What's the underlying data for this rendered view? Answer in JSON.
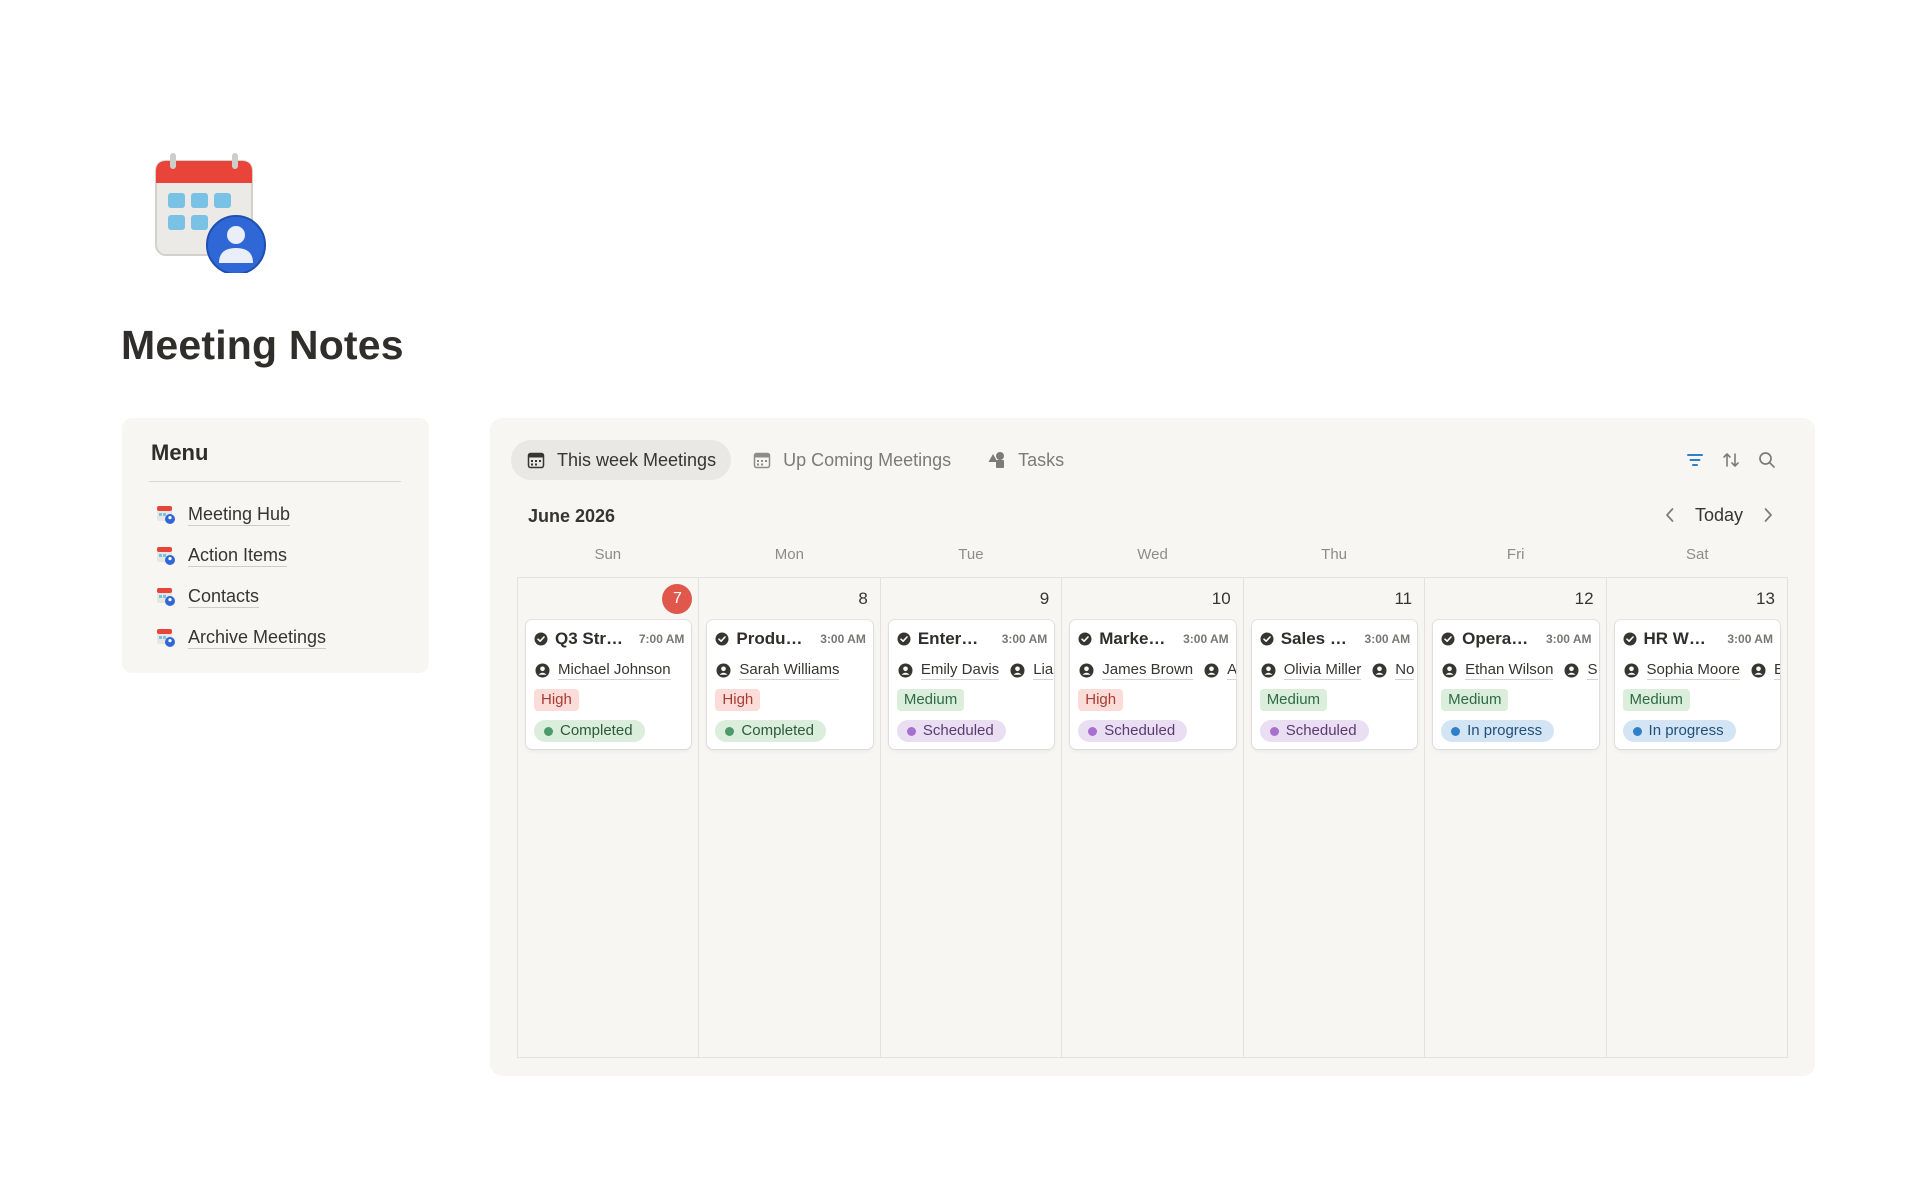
{
  "page": {
    "title": "Meeting Notes",
    "icon": "calendar-contact-icon"
  },
  "menu": {
    "title": "Menu",
    "items": [
      {
        "label": "Meeting Hub",
        "icon": "calendar-contact-icon"
      },
      {
        "label": "Action Items",
        "icon": "calendar-contact-icon"
      },
      {
        "label": "Contacts",
        "icon": "calendar-contact-icon"
      },
      {
        "label": "Archive Meetings",
        "icon": "calendar-contact-icon"
      }
    ]
  },
  "board": {
    "tabs": [
      {
        "label": "This week Meetings",
        "icon": "calendar-icon",
        "active": true
      },
      {
        "label": "Up Coming Meetings",
        "icon": "calendar-icon",
        "active": false
      },
      {
        "label": "Tasks",
        "icon": "shapes-icon",
        "active": false
      }
    ],
    "tools": [
      "filter-icon",
      "sort-icon",
      "search-icon"
    ],
    "month": "June 2026",
    "today_label": "Today",
    "weekdays": [
      "Sun",
      "Mon",
      "Tue",
      "Wed",
      "Thu",
      "Fri",
      "Sat"
    ],
    "days": [
      {
        "date": "7",
        "is_today": true,
        "event": {
          "title": "Q3 Str…",
          "time": "7:00 AM",
          "people": [
            "Michael Johnson"
          ],
          "priority": "High",
          "status": "Completed"
        }
      },
      {
        "date": "8",
        "is_today": false,
        "event": {
          "title": "Produ…",
          "time": "3:00 AM",
          "people": [
            "Sarah Williams"
          ],
          "priority": "High",
          "status": "Completed"
        }
      },
      {
        "date": "9",
        "is_today": false,
        "event": {
          "title": "Enter…",
          "time": "3:00 AM",
          "people": [
            "Emily Davis",
            "Lia"
          ],
          "priority": "Medium",
          "status": "Scheduled"
        }
      },
      {
        "date": "10",
        "is_today": false,
        "event": {
          "title": "Marke…",
          "time": "3:00 AM",
          "people": [
            "James Brown",
            "A"
          ],
          "priority": "High",
          "status": "Scheduled"
        }
      },
      {
        "date": "11",
        "is_today": false,
        "event": {
          "title": "Sales …",
          "time": "3:00 AM",
          "people": [
            "Olivia Miller",
            "No"
          ],
          "priority": "Medium",
          "status": "Scheduled"
        }
      },
      {
        "date": "12",
        "is_today": false,
        "event": {
          "title": "Opera…",
          "time": "3:00 AM",
          "people": [
            "Ethan Wilson",
            "S"
          ],
          "priority": "Medium",
          "status": "In progress"
        }
      },
      {
        "date": "13",
        "is_today": false,
        "event": {
          "title": "HR W…",
          "time": "3:00 AM",
          "people": [
            "Sophia Moore",
            "E"
          ],
          "priority": "Medium",
          "status": "In progress"
        }
      }
    ]
  }
}
